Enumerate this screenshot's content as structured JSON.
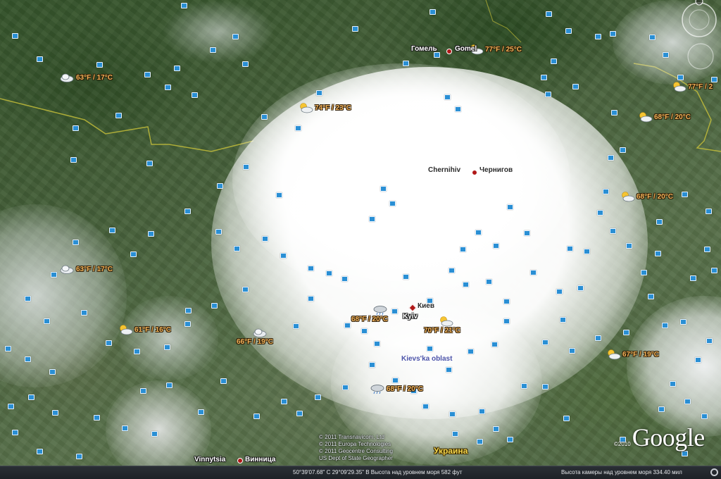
{
  "map": {
    "weather": [
      {
        "label": "63°F / 17°C",
        "icon": "cloudy"
      },
      {
        "label": "74°F / 23°C",
        "icon": "partly-cloudy"
      },
      {
        "label": "77°F / 25°C",
        "icon": "partly-cloudy"
      },
      {
        "label": "77°F / 2",
        "icon": "partly-cloudy"
      },
      {
        "label": "68°F / 20°C",
        "icon": "partly-cloudy"
      },
      {
        "label": "68°F / 20°C",
        "icon": "partly-cloudy"
      },
      {
        "label": "63°F / 17°C",
        "icon": "cloudy"
      },
      {
        "label": "61°F / 16°C",
        "icon": "partly-cloudy"
      },
      {
        "label": "66°F / 19°C",
        "icon": "cloudy"
      },
      {
        "label": "68°F / 20°C",
        "icon": "rain"
      },
      {
        "label": "70°F / 21°C",
        "icon": "partly-cloudy"
      },
      {
        "label": "67°F / 19°C",
        "icon": "partly-cloudy"
      },
      {
        "label": "68°F / 20°C",
        "icon": "rain"
      }
    ],
    "places": {
      "gomel_ru": "Гомель",
      "gomel_en": "Gomel",
      "chernihiv_en": "Chernihiv",
      "chernihiv_ru": "Чернигов",
      "kiev_ru": "Киев",
      "kyiv_en": "Kyiv",
      "vinnytsia_en": "Vinnytsia",
      "vinnytsia_ru": "Винница"
    },
    "region_label": "Kievs'ka oblast",
    "country_label": "Украина",
    "copyright": [
      "© 2011 Transnavicom, Ltd",
      "© 2011 Europa Technologies",
      "© 2011 Geocentre Consulting",
      "US Dept of State Geographer"
    ],
    "logo_year": "©2010",
    "logo_text": "Google"
  },
  "status_bar": {
    "coordinates": "50°39'07.68\" С   29°09'29.35\" В  Высота над уровнем моря   582 фут",
    "camera_altitude": "Высота камеры над уровнем моря   334.40 мил"
  },
  "colors": {
    "weather_text": "#f3b35a",
    "camera_marker": "#2a8fd4",
    "border_line": "#c9c23a",
    "city_dot": "#b01818"
  }
}
